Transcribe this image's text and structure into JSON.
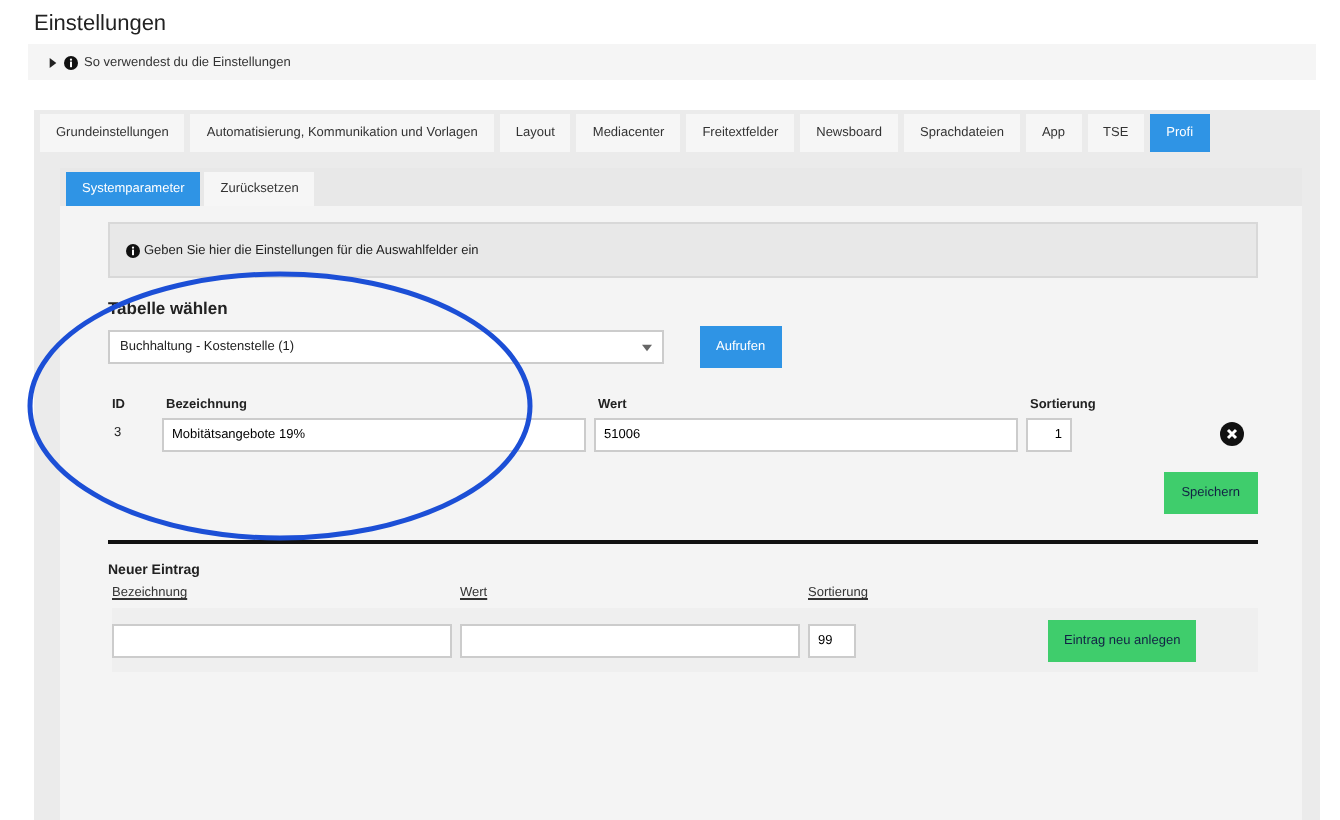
{
  "page_title": "Einstellungen",
  "help": {
    "label": "So verwendest du die Einstellungen",
    "expanded": false
  },
  "tabs": [
    {
      "label": "Grundeinstellungen",
      "selected": false
    },
    {
      "label": "Automatisierung, Kommunikation und Vorlagen",
      "selected": false
    },
    {
      "label": "Layout",
      "selected": false
    },
    {
      "label": "Mediacenter",
      "selected": false
    },
    {
      "label": "Freitextfelder",
      "selected": false
    },
    {
      "label": "Newsboard",
      "selected": false
    },
    {
      "label": "Sprachdateien",
      "selected": false
    },
    {
      "label": "App",
      "selected": false
    },
    {
      "label": "TSE",
      "selected": false
    },
    {
      "label": "Profi",
      "selected": true
    }
  ],
  "subtabs": [
    {
      "label": "Systemparameter",
      "selected": true
    },
    {
      "label": "Zurücksetzen",
      "selected": false
    }
  ],
  "info": "Geben Sie hier die Einstellungen für die Auswahlfelder ein",
  "table_select": {
    "label": "Tabelle wählen",
    "value": "Buchhaltung - Kostenstelle (1)",
    "button": "Aufrufen"
  },
  "entries": {
    "columns": [
      "ID",
      "Bezeichnung",
      "Wert",
      "Sortierung"
    ],
    "rows": [
      {
        "id": "3",
        "name": "Mobitätsangebote 19%",
        "value": "51006",
        "sort": "1"
      }
    ],
    "save": "Speichern"
  },
  "new_entry": {
    "title": "Neuer Eintrag",
    "columns": [
      "Bezeichnung",
      "Wert",
      "Sortierung"
    ],
    "sort": "99",
    "button": "Eintrag neu anlegen"
  }
}
